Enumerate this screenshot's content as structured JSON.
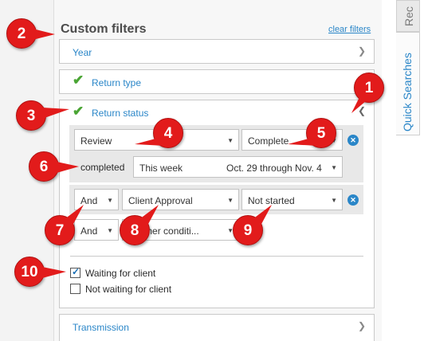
{
  "panel": {
    "title": "Custom filters",
    "clear_link": "clear filters",
    "filters": {
      "year": "Year",
      "return_type": "Return type",
      "return_status": "Return status",
      "transmission": "Transmission"
    }
  },
  "conditions": {
    "row1": {
      "field": "Review",
      "value": "Complete"
    },
    "row2": {
      "label": "completed",
      "range": "This week",
      "dates": "Oct. 29 through Nov. 4"
    },
    "row3": {
      "conj": "And",
      "field": "Client Approval",
      "value": "Not started"
    },
    "row4": {
      "conj": "And",
      "field": "another conditi..."
    }
  },
  "checkboxes": [
    {
      "label": "Waiting for client",
      "checked": true
    },
    {
      "label": "Not waiting for client",
      "checked": false
    }
  ],
  "tabs": {
    "tab1": "Rec",
    "tab2": "Quick Searches"
  },
  "callouts": [
    "1",
    "2",
    "3",
    "4",
    "5",
    "6",
    "7",
    "8",
    "9",
    "10"
  ],
  "colors": {
    "accent": "#2a86c8",
    "check": "#4aa534",
    "callout": "#e21b1b"
  }
}
